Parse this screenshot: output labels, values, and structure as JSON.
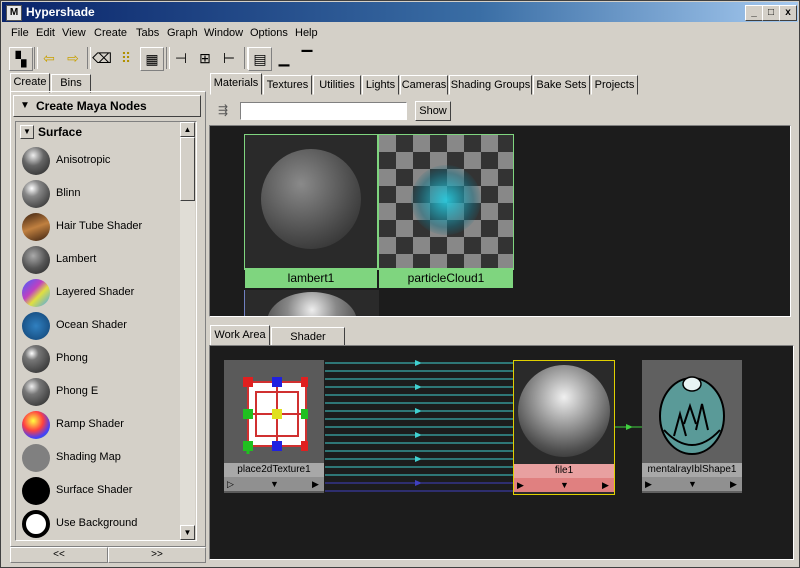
{
  "window": {
    "title": "Hypershade",
    "min": "_",
    "max": "□",
    "close": "x"
  },
  "menu": [
    "File",
    "Edit",
    "View",
    "Create",
    "Tabs",
    "Graph",
    "Window",
    "Options",
    "Help"
  ],
  "left_tabs": [
    "Create",
    "Bins"
  ],
  "create_header": "Create Maya Nodes",
  "section": "Surface",
  "nodes": [
    "Anisotropic",
    "Blinn",
    "Hair Tube Shader",
    "Lambert",
    "Layered Shader",
    "Ocean Shader",
    "Phong",
    "Phong E",
    "Ramp Shader",
    "Shading Map",
    "Surface Shader",
    "Use Background"
  ],
  "nav": {
    "prev": "<<",
    "next": ">>"
  },
  "top_tabs": [
    "Materials",
    "Textures",
    "Utilities",
    "Lights",
    "Cameras",
    "Shading Groups",
    "Bake Sets",
    "Projects"
  ],
  "show_button": "Show",
  "filter_value": "",
  "materials": [
    "lambert1",
    "particleCloud1"
  ],
  "bottom_tabs": [
    "Work Area",
    "Shader Library"
  ],
  "graph_nodes": [
    "place2dTexture1",
    "file1",
    "mentalrayIblShape1"
  ],
  "colors": {
    "selected": "#7fd57f",
    "file_node": "#e8a0a0",
    "connection": "#40d0d0"
  }
}
